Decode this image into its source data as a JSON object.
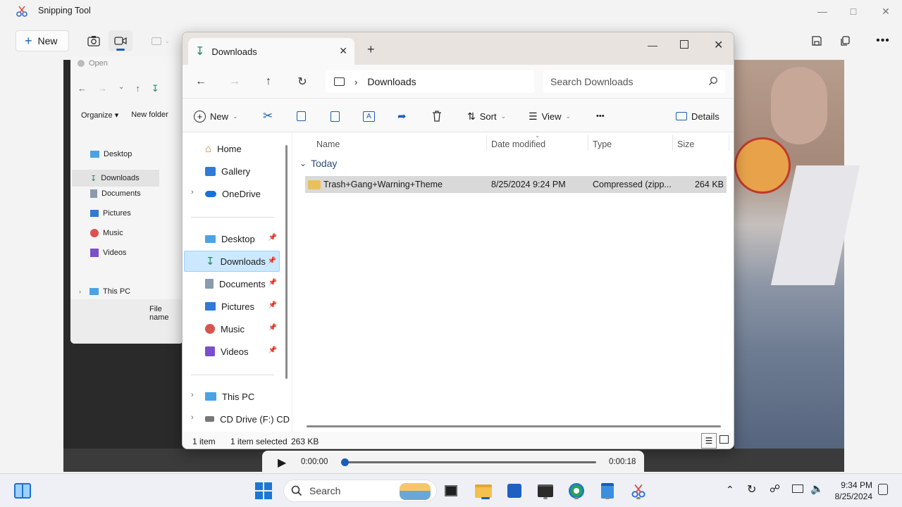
{
  "snip": {
    "title": "Snipping Tool",
    "new_label": "New"
  },
  "bg_explorer": {
    "open_label": "Open",
    "organize": "Organize",
    "new_folder": "New folder",
    "items": [
      "Desktop",
      "Downloads",
      "Documents",
      "Pictures",
      "Music",
      "Videos"
    ],
    "this_pc": "This PC",
    "file_name": "File name"
  },
  "explorer": {
    "tab_title": "Downloads",
    "breadcrumb": "Downloads",
    "search_placeholder": "Search Downloads",
    "cmd": {
      "new": "New",
      "sort": "Sort",
      "view": "View",
      "more": "•••",
      "details": "Details"
    },
    "nav": {
      "home": "Home",
      "gallery": "Gallery",
      "onedrive": "OneDrive",
      "desktop": "Desktop",
      "downloads": "Downloads",
      "documents": "Documents",
      "pictures": "Pictures",
      "music": "Music",
      "videos": "Videos",
      "thispc": "This PC",
      "cddrive": "CD Drive (F:) CD"
    },
    "columns": {
      "name": "Name",
      "date": "Date modified",
      "type": "Type",
      "size": "Size"
    },
    "group": "Today",
    "files": [
      {
        "name": "Trash+Gang+Warning+Theme",
        "date": "8/25/2024 9:24 PM",
        "type": "Compressed (zipp...",
        "size": "264 KB"
      }
    ],
    "status": {
      "count": "1 item",
      "selected": "1 item selected",
      "selsize": "263 KB"
    }
  },
  "media": {
    "current": "0:00:00",
    "total": "0:00:18",
    "progress": 0
  },
  "taskbar": {
    "search": "Search",
    "time": "9:34 PM",
    "date": "8/25/2024"
  }
}
